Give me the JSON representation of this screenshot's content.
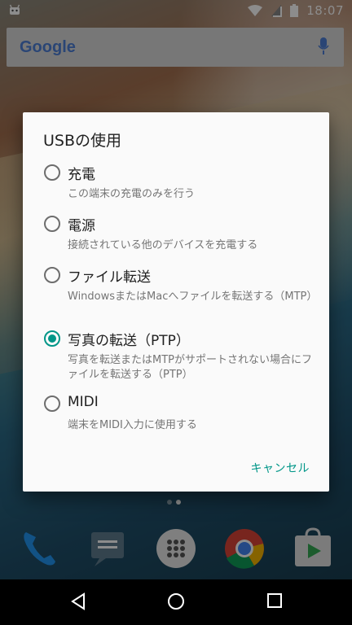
{
  "status_bar": {
    "time": "18:07"
  },
  "search": {
    "logo": "Google"
  },
  "dialog": {
    "title": "USBの使用",
    "options": [
      {
        "label": "充電",
        "description": "この端末の充電のみを行う",
        "selected": false
      },
      {
        "label": "電源",
        "description": "接続されている他のデバイスを充電する",
        "selected": false
      },
      {
        "label": "ファイル転送",
        "description": "WindowsまたはMacへファイルを転送する（MTP）",
        "selected": false
      },
      {
        "label": "写真の転送（PTP）",
        "description": "写真を転送またはMTPがサポートされない場合にファイルを転送する（PTP）",
        "selected": true
      },
      {
        "label": "MIDI",
        "description": "端末をMIDI入力に使用する",
        "selected": false
      }
    ],
    "cancel": "キャンセル"
  },
  "colors": {
    "accent": "#009688",
    "dialog_bg": "#fafafa"
  },
  "icons": {
    "dock": [
      "phone-icon",
      "messages-icon",
      "app-drawer-icon",
      "chrome-icon",
      "play-store-icon"
    ],
    "nav": [
      "back-icon",
      "home-icon",
      "recents-icon"
    ]
  }
}
